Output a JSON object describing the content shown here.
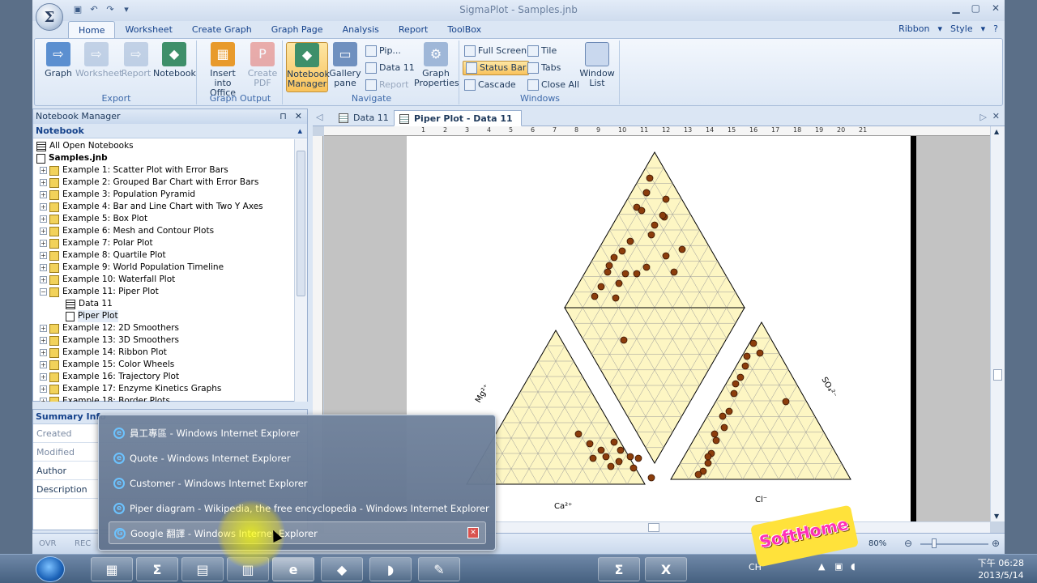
{
  "window": {
    "title": "SigmaPlot - Samples.jnb"
  },
  "ribbon": {
    "tabs": [
      "Home",
      "Worksheet",
      "Create Graph",
      "Graph Page",
      "Analysis",
      "Report",
      "ToolBox"
    ],
    "right": {
      "ribbon": "Ribbon",
      "style": "Style"
    },
    "groups": {
      "export": {
        "label": "Export",
        "buttons": [
          "Graph",
          "Worksheet",
          "Report",
          "Notebook"
        ]
      },
      "graph_output": {
        "label": "Graph Output",
        "buttons": [
          "Insert into Office",
          "Create PDF"
        ]
      },
      "navigate": {
        "label": "Navigate",
        "big": [
          "Notebook Manager",
          "Gallery pane"
        ],
        "small": [
          "Pip...",
          "Data 11",
          "Report"
        ],
        "graph_properties": "Graph Properties"
      },
      "windows": {
        "label": "Windows",
        "small": [
          "Full Screen",
          "Status Bar",
          "Cascade",
          "Tile",
          "Tabs",
          "Close All"
        ],
        "window_list": "Window List"
      }
    }
  },
  "notebook_manager": {
    "title": "Notebook Manager",
    "section": "Notebook",
    "items": [
      "All Open Notebooks",
      "Samples.jnb",
      "Example 1: Scatter Plot with Error Bars",
      "Example 2: Grouped Bar Chart with Error Bars",
      "Example 3: Population Pyramid",
      "Example 4: Bar and Line Chart with Two Y Axes",
      "Example 5: Box Plot",
      "Example 6: Mesh and Contour Plots",
      "Example 7: Polar Plot",
      "Example 8: Quartile Plot",
      "Example 9: World Population Timeline",
      "Example 10: Waterfall Plot",
      "Example 11: Piper Plot",
      "Data 11",
      "Piper Plot",
      "Example 12: 2D Smoothers",
      "Example 13: 3D Smoothers",
      "Example 14: Ribbon Plot",
      "Example 15: Color Wheels",
      "Example 16: Trajectory Plot",
      "Example 17: Enzyme Kinetics Graphs",
      "Example 18: Border Plots"
    ]
  },
  "summary": {
    "title": "Summary Info",
    "fields": [
      "Created",
      "Modified",
      "Author",
      "Description"
    ]
  },
  "documents": {
    "tabs": [
      "Data 11",
      "Piper Plot - Data 11"
    ],
    "ruler": [
      "1",
      "2",
      "3",
      "4",
      "5",
      "6",
      "7",
      "8",
      "9",
      "10",
      "11",
      "12",
      "13",
      "14",
      "15",
      "16",
      "17",
      "18",
      "19",
      "20",
      "21"
    ],
    "plot_labels": {
      "ca": "Ca²⁺",
      "cl": "Cl⁻",
      "mg": "Mg²⁺",
      "so4": "SO₄²⁻"
    }
  },
  "statusbar": {
    "ovr": "OVR",
    "rec": "REC",
    "zoom": "80%"
  },
  "jumplist": {
    "items": [
      "員工專區 - Windows Internet Explorer",
      "Quote - Windows Internet Explorer",
      "Customer - Windows Internet Explorer",
      "Piper diagram - Wikipedia, the free encyclopedia - Windows Internet Explorer",
      "Google 翻譯 - Windows Internet Explorer"
    ]
  },
  "taskbar": {
    "lang": "CH",
    "time": "下午 06:28",
    "date": "2013/5/14"
  },
  "watermark": "SoftHome",
  "colors": {
    "accent": "#15428b",
    "plot_fill": "#fdf6c3",
    "point": "#8b3d0c",
    "ribbon_bg": "#dbe6f4"
  }
}
